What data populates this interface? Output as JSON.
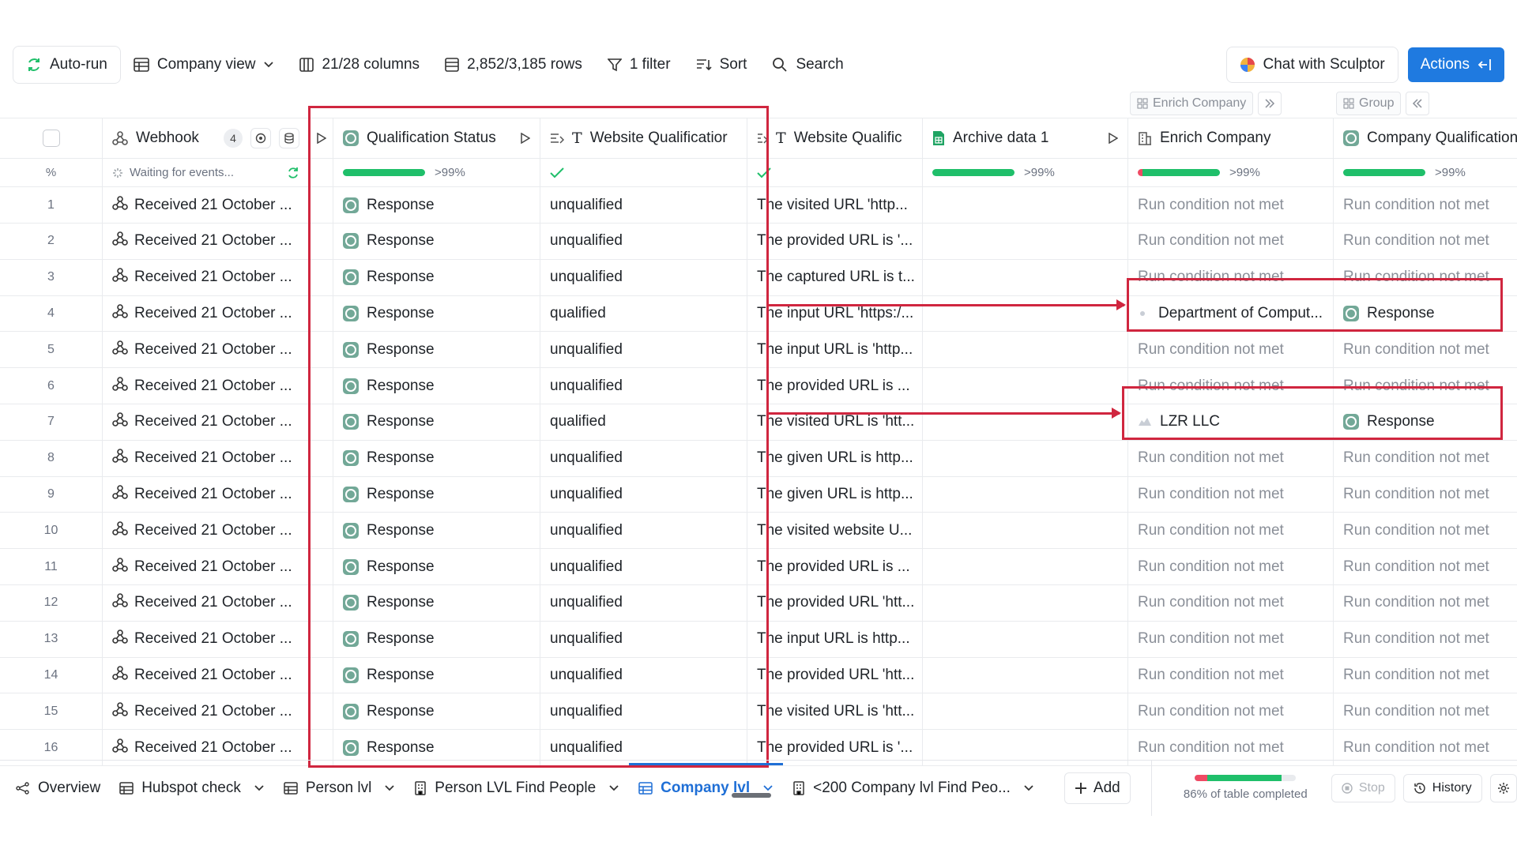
{
  "toolbar": {
    "autorun": "Auto-run",
    "view": "Company view",
    "columns": "21/28 columns",
    "rows": "2,852/3,185 rows",
    "filter": "1 filter",
    "sort": "Sort",
    "search": "Search",
    "sculptor": "Chat with Sculptor",
    "actions": "Actions"
  },
  "groups": {
    "enrich": "Enrich Company",
    "group": "Group"
  },
  "columns": {
    "webhook": "Webhook",
    "webhook_count": "4",
    "qual_status": "Qualification Status",
    "website_qual_1": "Website Qualificatior",
    "website_qual_2": "Website Qualific",
    "archive": "Archive data 1",
    "enrich": "Enrich Company",
    "company_qual": "Company Qualification"
  },
  "stats": {
    "percent_label": "%",
    "waiting": "Waiting for events...",
    "qual_pct": ">99%",
    "archive_pct": ">99%",
    "enrich_pct": ">99%",
    "company_pct": ">99%",
    "progress_fraction": 0.99
  },
  "rows": [
    {
      "n": "1",
      "webhook": "Received 21 October ...",
      "status": "Response",
      "qual": "unqualified",
      "desc": "The visited URL 'http...",
      "enrich": "Run condition not met",
      "company": "Run condition not met"
    },
    {
      "n": "2",
      "webhook": "Received 21 October ...",
      "status": "Response",
      "qual": "unqualified",
      "desc": "The provided URL is '...",
      "enrich": "Run condition not met",
      "company": "Run condition not met"
    },
    {
      "n": "3",
      "webhook": "Received 21 October ...",
      "status": "Response",
      "qual": "unqualified",
      "desc": "The captured URL is t...",
      "enrich": "Run condition not met",
      "company": "Run condition not met"
    },
    {
      "n": "4",
      "webhook": "Received 21 October ...",
      "status": "Response",
      "qual": "qualified",
      "desc": "The input URL 'https:/...",
      "enrich": "Department of Comput...",
      "company": "Response"
    },
    {
      "n": "5",
      "webhook": "Received 21 October ...",
      "status": "Response",
      "qual": "unqualified",
      "desc": "The input URL is 'http...",
      "enrich": "Run condition not met",
      "company": "Run condition not met"
    },
    {
      "n": "6",
      "webhook": "Received 21 October ...",
      "status": "Response",
      "qual": "unqualified",
      "desc": "The provided URL is ...",
      "enrich": "Run condition not met",
      "company": "Run condition not met"
    },
    {
      "n": "7",
      "webhook": "Received 21 October ...",
      "status": "Response",
      "qual": "qualified",
      "desc": "The visited URL is 'htt...",
      "enrich": "LZR LLC",
      "company": "Response"
    },
    {
      "n": "8",
      "webhook": "Received 21 October ...",
      "status": "Response",
      "qual": "unqualified",
      "desc": "The given URL is http...",
      "enrich": "Run condition not met",
      "company": "Run condition not met"
    },
    {
      "n": "9",
      "webhook": "Received 21 October ...",
      "status": "Response",
      "qual": "unqualified",
      "desc": "The given URL is http...",
      "enrich": "Run condition not met",
      "company": "Run condition not met"
    },
    {
      "n": "10",
      "webhook": "Received 21 October ...",
      "status": "Response",
      "qual": "unqualified",
      "desc": "The visited website U...",
      "enrich": "Run condition not met",
      "company": "Run condition not met"
    },
    {
      "n": "11",
      "webhook": "Received 21 October ...",
      "status": "Response",
      "qual": "unqualified",
      "desc": "The provided URL is ...",
      "enrich": "Run condition not met",
      "company": "Run condition not met"
    },
    {
      "n": "12",
      "webhook": "Received 21 October ...",
      "status": "Response",
      "qual": "unqualified",
      "desc": "The provided URL 'htt...",
      "enrich": "Run condition not met",
      "company": "Run condition not met"
    },
    {
      "n": "13",
      "webhook": "Received 21 October ...",
      "status": "Response",
      "qual": "unqualified",
      "desc": "The input URL is http...",
      "enrich": "Run condition not met",
      "company": "Run condition not met"
    },
    {
      "n": "14",
      "webhook": "Received 21 October ...",
      "status": "Response",
      "qual": "unqualified",
      "desc": "The provided URL 'htt...",
      "enrich": "Run condition not met",
      "company": "Run condition not met"
    },
    {
      "n": "15",
      "webhook": "Received 21 October ...",
      "status": "Response",
      "qual": "unqualified",
      "desc": "The visited URL is 'htt...",
      "enrich": "Run condition not met",
      "company": "Run condition not met"
    },
    {
      "n": "16",
      "webhook": "Received 21 October ...",
      "status": "Response",
      "qual": "unqualified",
      "desc": "The provided URL is '...",
      "enrich": "Run condition not met",
      "company": "Run condition not met"
    }
  ],
  "tabs": [
    {
      "label": "Overview",
      "icon": "overview-icon",
      "active": false,
      "chevron": false
    },
    {
      "label": "Hubspot check",
      "icon": "table-icon",
      "active": false,
      "chevron": true
    },
    {
      "label": "Person lvl",
      "icon": "table-icon",
      "active": false,
      "chevron": true
    },
    {
      "label": "Person LVL Find People",
      "icon": "building-icon",
      "active": false,
      "chevron": true
    },
    {
      "label": "Company lvl",
      "icon": "table-icon",
      "active": true,
      "chevron": true
    },
    {
      "label": "<200 Company lvl Find Peo...",
      "icon": "building-icon",
      "active": false,
      "chevron": true
    }
  ],
  "bottom": {
    "add": "Add",
    "completion": "86% of table completed",
    "completion_fraction": 0.86,
    "stop": "Stop",
    "history": "History"
  },
  "colors": {
    "accent": "#1f7ae0",
    "progress": "#1fbf6a",
    "annotation": "#d0263f",
    "gpt": "#72a897"
  }
}
